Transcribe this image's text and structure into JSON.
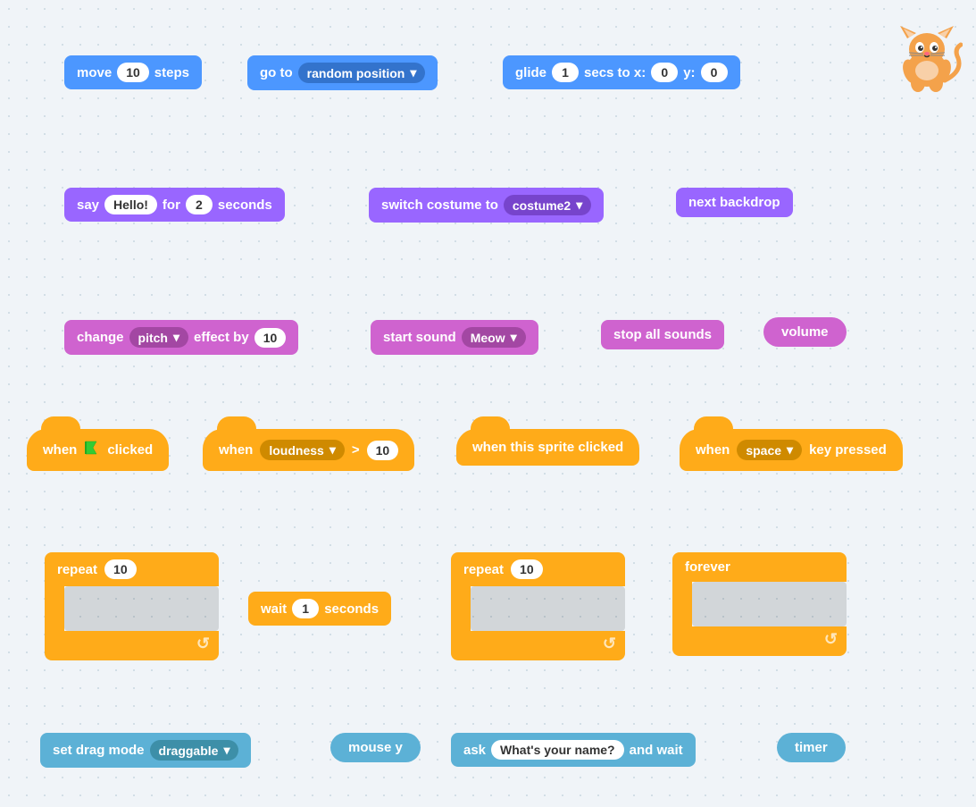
{
  "blocks": {
    "move": {
      "label": "move",
      "value": "10",
      "suffix": "steps"
    },
    "goto": {
      "label": "go to",
      "dropdown": "random position"
    },
    "glide": {
      "label": "glide",
      "secs": "1",
      "suffix": "secs to x:",
      "x": "0",
      "y_label": "y:",
      "y": "0"
    },
    "say": {
      "label": "say",
      "message": "Hello!",
      "for": "for",
      "secs": "2",
      "suffix": "seconds"
    },
    "switch_costume": {
      "label": "switch costume to",
      "dropdown": "costume2"
    },
    "next_backdrop": {
      "label": "next backdrop"
    },
    "change_effect": {
      "label": "change",
      "dropdown": "pitch",
      "suffix": "effect by",
      "value": "10"
    },
    "start_sound": {
      "label": "start sound",
      "dropdown": "Meow"
    },
    "stop_sounds": {
      "label": "stop all sounds"
    },
    "volume": {
      "label": "volume"
    },
    "when_flag": {
      "label": "when",
      "suffix": "clicked"
    },
    "when_loudness": {
      "label": "when",
      "dropdown": "loudness",
      "op": ">",
      "value": "10"
    },
    "when_sprite": {
      "label": "when this sprite clicked"
    },
    "when_key": {
      "label": "when",
      "dropdown": "space",
      "suffix": "key pressed"
    },
    "repeat1": {
      "label": "repeat",
      "value": "10"
    },
    "wait": {
      "label": "wait",
      "value": "1",
      "suffix": "seconds"
    },
    "repeat2": {
      "label": "repeat",
      "value": "10"
    },
    "forever": {
      "label": "forever"
    },
    "set_drag": {
      "label": "set drag mode",
      "dropdown": "draggable"
    },
    "mouse_y": {
      "label": "mouse y"
    },
    "ask": {
      "label": "ask",
      "question": "What's your name?",
      "suffix": "and wait"
    },
    "timer": {
      "label": "timer"
    }
  }
}
